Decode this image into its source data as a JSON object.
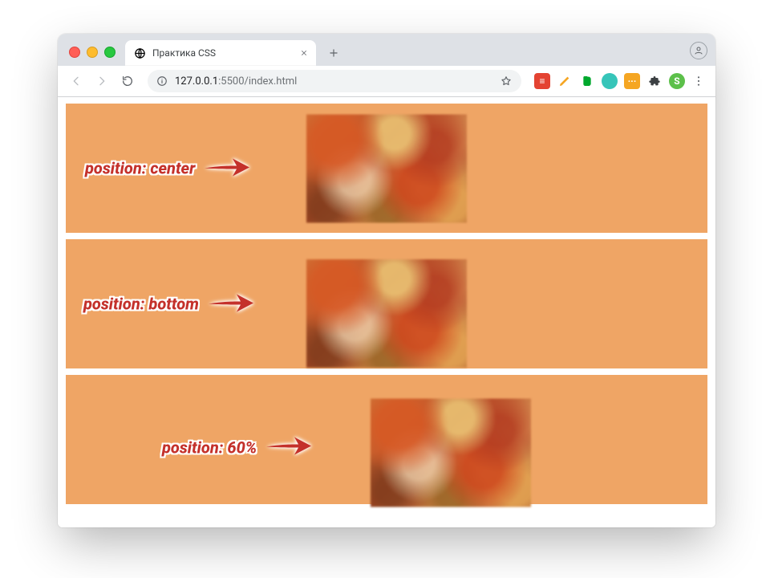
{
  "tab": {
    "title": "Практика CSS"
  },
  "url": {
    "host": "127.0.0.1",
    "port": ":5500",
    "path": "/index.html"
  },
  "panels": [
    {
      "label": "position: center"
    },
    {
      "label": "position: bottom"
    },
    {
      "label": "position: 60%"
    }
  ]
}
